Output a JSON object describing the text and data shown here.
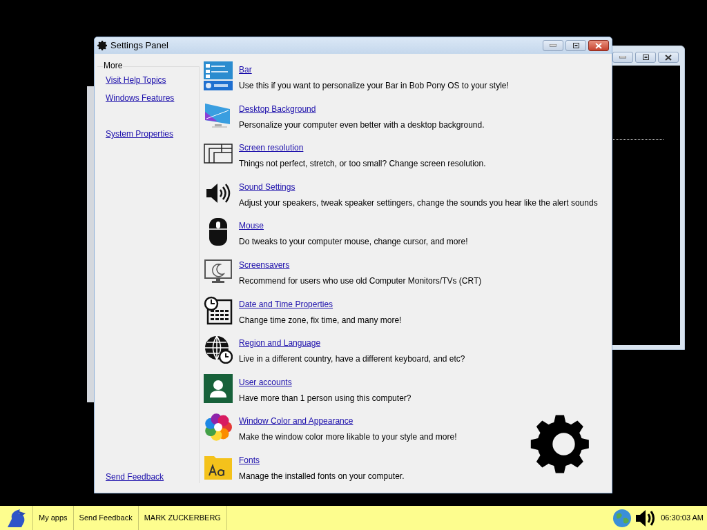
{
  "window": {
    "title": "Settings Panel"
  },
  "sidebar": {
    "heading": "More",
    "links": [
      "Visit Help Topics",
      "Windows Features",
      "System Properties"
    ],
    "footer_link": "Send Feedback"
  },
  "items": [
    {
      "title": "Bar",
      "description": "Use this if you want to personalize your Bar in Bob Pony OS to your style!"
    },
    {
      "title": "Desktop Background",
      "description": "Personalize your computer even better with a desktop background."
    },
    {
      "title": "Screen resolution",
      "description": "Things not perfect, stretch, or too small? Change screen resolution."
    },
    {
      "title": "Sound Settings",
      "description": "Adjust your speakers, tweak speaker settingers, change the sounds you hear like the alert sounds"
    },
    {
      "title": "Mouse",
      "description": "Do tweaks to your computer mouse, change cursor, and more!"
    },
    {
      "title": "Screensavers",
      "description": "Recommend for users who use old Computer Monitors/TVs (CRT)"
    },
    {
      "title": "Date and Time Properties",
      "description": "Change time zone, fix time, and many more!"
    },
    {
      "title": "Region and Language",
      "description": "Live in a different country, have a different keyboard, and etc?"
    },
    {
      "title": "User accounts",
      "description": "Have more than 1 person using this computer?"
    },
    {
      "title": "Window Color and Appearance",
      "description": "Make the window color more likable to your style and more!"
    },
    {
      "title": "Fonts",
      "description": "Manage the installed fonts on your computer."
    }
  ],
  "taskbar": {
    "buttons": [
      "My apps",
      "Send Feedback",
      "MARK ZUCKERBERG"
    ],
    "clock": "06:30:03 AM"
  }
}
